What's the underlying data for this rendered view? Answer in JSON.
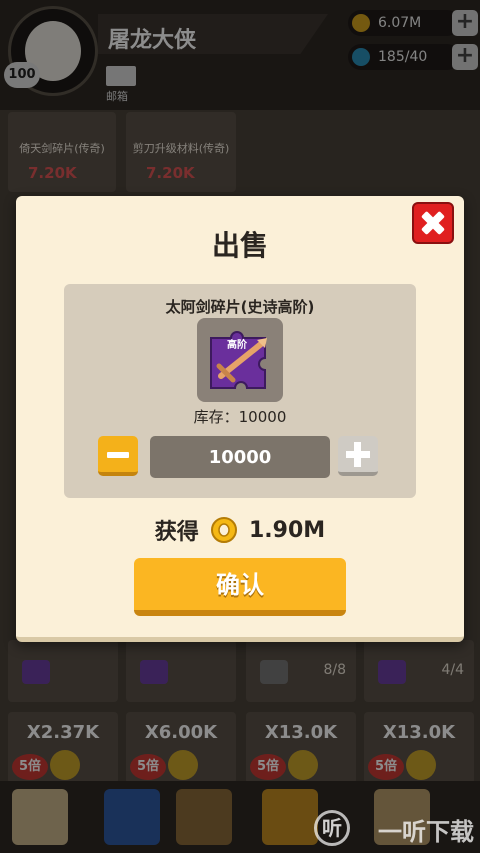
{
  "player": {
    "name": "屠龙大侠",
    "level": "100",
    "mail_label": "邮箱"
  },
  "resources": {
    "gold": "6.07M",
    "gems": "185/40"
  },
  "background": {
    "cards": [
      {
        "title": "倚天剑碎片(传奇)",
        "price": "7.20K"
      },
      {
        "title": "剪刀升级材料(传奇)",
        "price": "7.20K"
      }
    ],
    "items": [
      "",
      "",
      "8/8",
      "4/4"
    ],
    "multipliers": [
      {
        "value": "X2.37K",
        "badge": "5倍"
      },
      {
        "value": "X6.00K",
        "badge": "5倍"
      },
      {
        "value": "X13.0K",
        "badge": "5倍"
      },
      {
        "value": "X13.0K",
        "badge": "5倍"
      }
    ],
    "watermark": "一听下载",
    "watermark_logo": "听"
  },
  "dialog": {
    "title": "出售",
    "item_name": "太阿剑碎片(史诗高阶)",
    "item_tag": "高阶",
    "stock_text": "库存：10000",
    "quantity": "10000",
    "reward_label": "获得",
    "reward_value": "1.90M",
    "confirm_label": "确认"
  },
  "colors": {
    "confirm": "#fbb622",
    "close": "#e02020",
    "panel": "#d6ccbb",
    "dialog_bg": "#fbf0d8"
  }
}
